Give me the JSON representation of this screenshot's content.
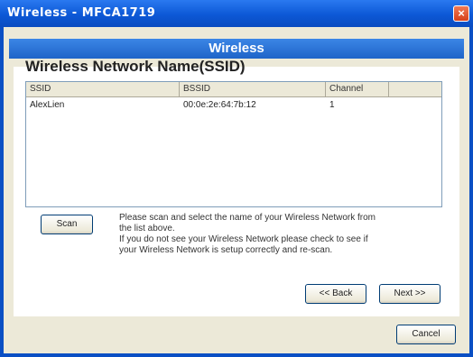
{
  "window": {
    "title": "Wireless - MFCA1719",
    "close_label": "×"
  },
  "banner": {
    "title": "Wireless"
  },
  "section": {
    "heading": "Wireless Network Name(SSID)"
  },
  "network_table": {
    "columns": [
      "SSID",
      "BSSID",
      "Channel"
    ],
    "rows": [
      {
        "ssid": "AlexLien",
        "bssid": "00:0e:2e:64:7b:12",
        "channel": "1"
      }
    ]
  },
  "buttons": {
    "scan": "Scan",
    "back": "<< Back",
    "next": "Next >>",
    "cancel": "Cancel"
  },
  "help_text": {
    "line1": "Please scan and select the name of your Wireless Network from",
    "line2": "the list above.",
    "line3": "If you do not see your Wireless Network please check to see if",
    "line4": "your Wireless Network is setup correctly and re-scan."
  }
}
